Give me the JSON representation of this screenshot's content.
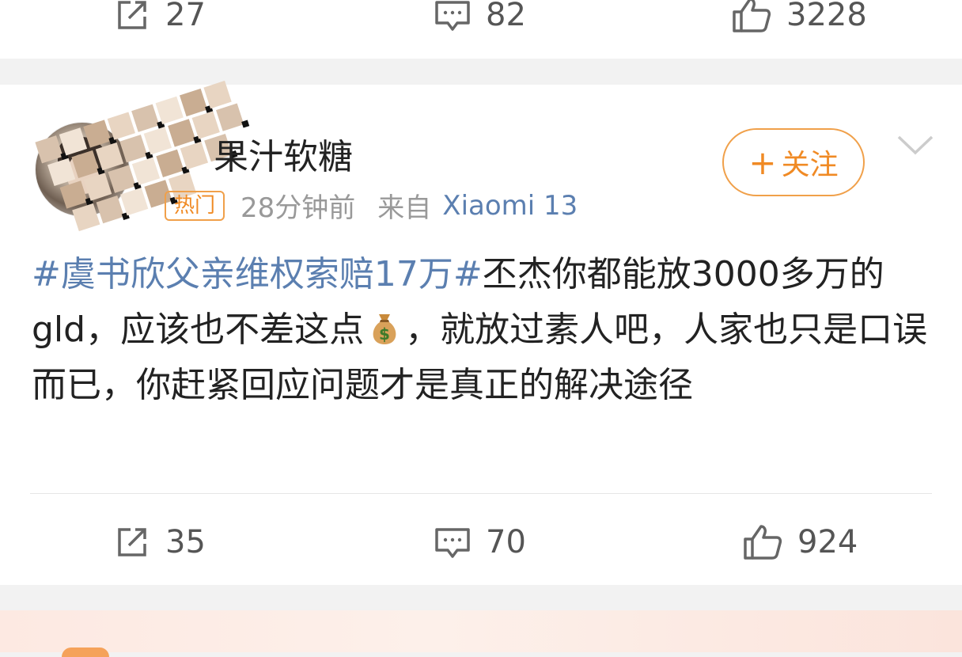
{
  "prev_post": {
    "repost_count": "27",
    "comment_count": "82",
    "like_count": "3228"
  },
  "post": {
    "username": "果汁软糖",
    "hot_badge": "热门",
    "time": "28分钟前",
    "source_prefix": "来自",
    "device": "Xiaomi 13",
    "follow_label": "关注",
    "follow_plus": "+",
    "text": {
      "hashtag": "#虞书欣父亲维权索赔17万#",
      "part1": "丕杰你都能放3000多万的gld，应该也不差这点",
      "emoji": "money-bag",
      "part2": "，就放过素人吧，人家也只是口误而已，你赶紧回应问题才是真正的解决途径"
    },
    "repost_count": "35",
    "comment_count": "70",
    "like_count": "924"
  },
  "colors": {
    "accent": "#f08a24",
    "link": "#5b7fb0",
    "background": "#f2f2f2"
  }
}
